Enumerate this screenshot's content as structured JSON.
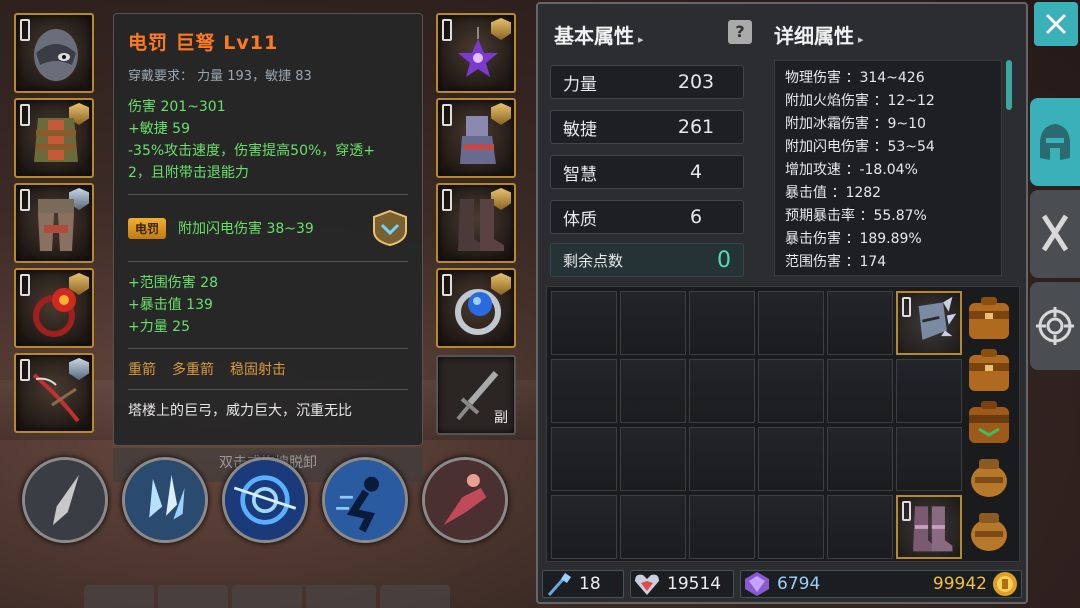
{
  "tooltip": {
    "title": "电罚 巨弩 Lv11",
    "requirement": "穿戴要求：  力量 193，敏捷 83",
    "base_damage": "伤害   201~301",
    "agility_bonus": "+敏捷  59",
    "special_1": " -35%攻击速度，伤害提高50%，穿透+",
    "special_2": "2，且附带击退能力",
    "effect_badge": "电罚",
    "effect_text": "附加闪电伤害 38~39",
    "bonus_1": "+范围伤害  28",
    "bonus_2": "+暴击值  139",
    "bonus_3": "+力量  25",
    "skills": [
      "重箭",
      "多重箭",
      "稳固射击"
    ],
    "description": "塔楼上的巨弓，威力巨大，沉重无比"
  },
  "unequip_hint": "双击或拖拽脱卸",
  "weapon2_label": "副",
  "basic": {
    "title": "基本属性",
    "help": "?",
    "stats": [
      {
        "label": "力量",
        "value": "203"
      },
      {
        "label": "敏捷",
        "value": "261"
      },
      {
        "label": "智慧",
        "value": "4"
      },
      {
        "label": "体质",
        "value": "6"
      }
    ],
    "points_label": "剩余点数",
    "points_value": "0"
  },
  "detail": {
    "title": "详细属性",
    "lines": [
      "物理伤害 ：314~426",
      "附加火焰伤害 ：12~12",
      "附加冰霜伤害 ：9~10",
      "附加闪电伤害 ：53~54",
      "增加攻速 ：-18.04%",
      "暴击值 ：1282",
      "预期暴击率 ：55.87%",
      "暴击伤害 ：189.89%",
      "范围伤害 ：174"
    ]
  },
  "currency": {
    "wand": "18",
    "gem": "19514",
    "crystal": "6794",
    "gold": "99942"
  },
  "colors": {
    "accent": "#3ab0b8",
    "title_orange": "#ff7a1e",
    "affix_green": "#68e06a",
    "frame_gold": "#b8892a"
  }
}
